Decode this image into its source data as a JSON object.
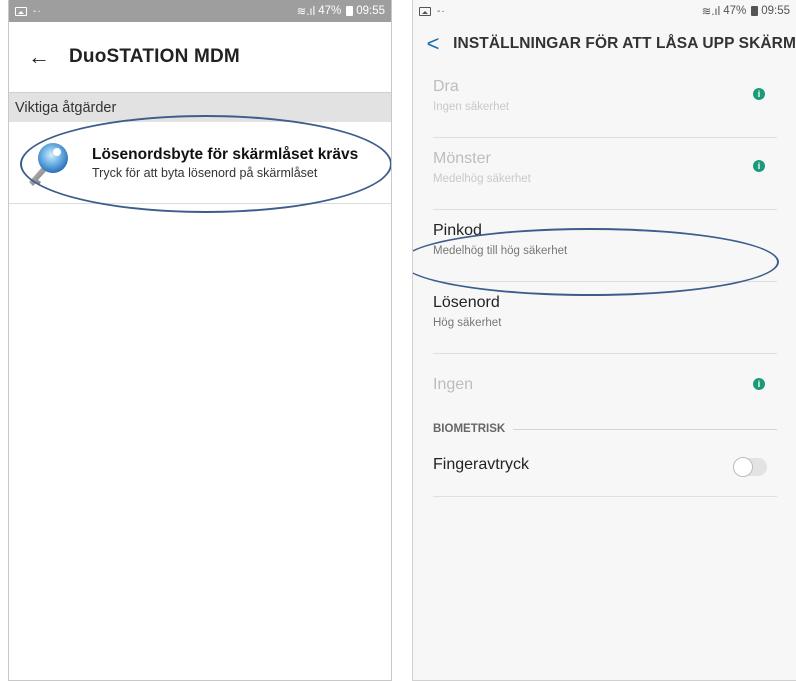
{
  "left": {
    "status": {
      "dots": "-·",
      "signal": "≋.ıl",
      "battery_pct": "47%",
      "time": "09:55"
    },
    "app_title": "DuoSTATION MDM",
    "section_header": "Viktiga åtgärder",
    "notification": {
      "title": "Lösenordsbyte för skärmlåset krävs",
      "subtitle": "Tryck för att byta lösenord på skärmlåset"
    }
  },
  "right": {
    "status": {
      "dots": "-·",
      "signal": "≋.ıl",
      "battery_pct": "47%",
      "time": "09:55"
    },
    "title": "INSTÄLLNINGAR FÖR ATT LÅSA UPP SKÄRM",
    "options": [
      {
        "title": "Dra",
        "subtitle": "Ingen säkerhet"
      },
      {
        "title": "Mönster",
        "subtitle": "Medelhög säkerhet"
      },
      {
        "title": "Pinkod",
        "subtitle": "Medelhög till hög säkerhet"
      },
      {
        "title": "Lösenord",
        "subtitle": "Hög säkerhet"
      },
      {
        "title": "Ingen"
      }
    ],
    "biometric_header": "BIOMETRISK",
    "fingerprint": {
      "label": "Fingeravtryck",
      "enabled": false
    }
  },
  "colors": {
    "accent": "#1a6fb0",
    "info": "#1b9a79",
    "annotation": "#3d5d8c"
  },
  "icons": {
    "back": "←",
    "chevron": "<",
    "info": "i"
  }
}
